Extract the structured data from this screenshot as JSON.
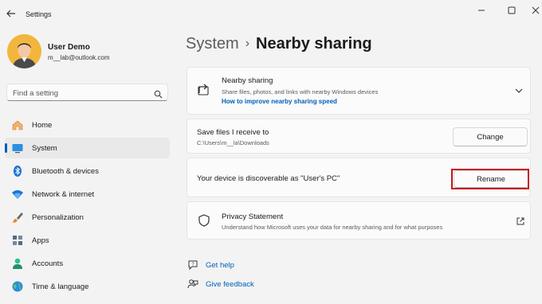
{
  "window": {
    "app_title": "Settings"
  },
  "user": {
    "name": "User Demo",
    "email": "m__lab@outlook.com"
  },
  "search": {
    "placeholder": "Find a setting"
  },
  "sidebar": {
    "items": [
      {
        "label": "Home",
        "icon": "home-icon"
      },
      {
        "label": "System",
        "icon": "system-icon",
        "active": true
      },
      {
        "label": "Bluetooth & devices",
        "icon": "bluetooth-icon"
      },
      {
        "label": "Network & internet",
        "icon": "wifi-icon"
      },
      {
        "label": "Personalization",
        "icon": "brush-icon"
      },
      {
        "label": "Apps",
        "icon": "apps-icon"
      },
      {
        "label": "Accounts",
        "icon": "accounts-icon"
      },
      {
        "label": "Time & language",
        "icon": "globe-icon"
      }
    ]
  },
  "breadcrumb": {
    "parent": "System",
    "separator": "›",
    "current": "Nearby sharing"
  },
  "nearby": {
    "title": "Nearby sharing",
    "subtitle": "Share files, photos, and links with nearby Windows devices",
    "link": "How to improve nearby sharing speed"
  },
  "save_files": {
    "title": "Save files I receive to",
    "path": "C:\\Users\\m__la\\Downloads",
    "button": "Change"
  },
  "discoverable": {
    "title": "Your device is discoverable as \"User's PC\"",
    "button": "Rename"
  },
  "privacy": {
    "title": "Privacy Statement",
    "subtitle": "Understand how Microsoft uses your data for nearby sharing and for what purposes"
  },
  "help": {
    "get_help": "Get help",
    "give_feedback": "Give feedback"
  },
  "colors": {
    "accent": "#005fb8",
    "highlight": "#c4121d",
    "background": "#f3f3f3"
  }
}
